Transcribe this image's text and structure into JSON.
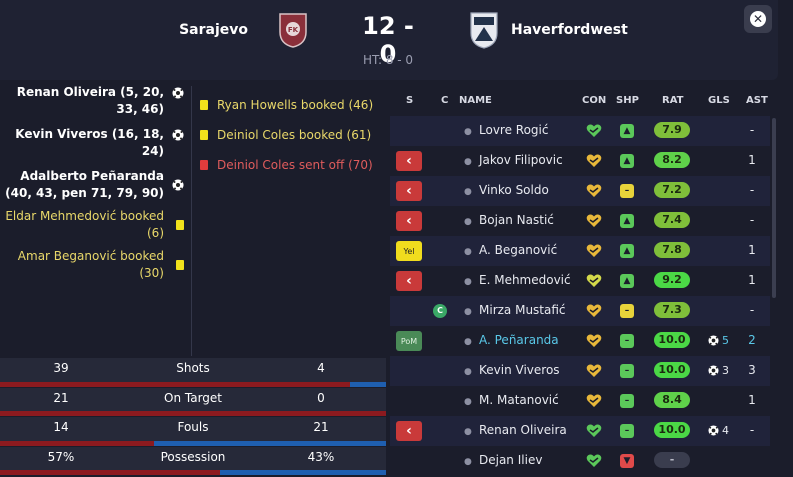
{
  "header": {
    "home_team": "Sarajevo",
    "away_team": "Haverfordwest",
    "score": "12 - 0",
    "half_time": "HT: 8 - 0",
    "close_icon": "close-icon"
  },
  "home_events": [
    {
      "type": "goal",
      "text": "Renan Oliveira (5, 20, 33, 46)"
    },
    {
      "type": "goal",
      "text": "Kevin Viveros (16, 18, 24)"
    },
    {
      "type": "goal",
      "text": "Adalberto Peñaranda (40, 43, pen 71, 79, 90)"
    },
    {
      "type": "book",
      "text": "Eldar Mehmedović booked (6)"
    },
    {
      "type": "book",
      "text": "Amar Beganović booked (30)"
    }
  ],
  "away_events": [
    {
      "type": "book",
      "text": "Ryan Howells booked (46)"
    },
    {
      "type": "book",
      "text": "Deiniol Coles booked (61)"
    },
    {
      "type": "off",
      "text": "Deiniol Coles sent off (70)"
    }
  ],
  "stats": [
    {
      "label": "Shots",
      "home": "39",
      "away": "4",
      "home_share": 0.907
    },
    {
      "label": "On Target",
      "home": "21",
      "away": "0",
      "home_share": 1.0
    },
    {
      "label": "Fouls",
      "home": "14",
      "away": "21",
      "home_share": 0.4
    },
    {
      "label": "Possession",
      "home": "57%",
      "away": "43%",
      "home_share": 0.57
    }
  ],
  "table": {
    "headers": {
      "s": "S",
      "c": "C",
      "name": "NAME",
      "con": "CON",
      "shp": "SHP",
      "rat": "RAT",
      "gls": "GLS",
      "ast": "AST"
    },
    "rows": [
      {
        "s": "",
        "name": "Lovre Rogić",
        "shp": "up",
        "rat": "7.9",
        "gls": "",
        "ast": "-"
      },
      {
        "s": "sub",
        "name": "Jakov Filipovic",
        "shp": "up",
        "rat": "8.2",
        "gls": "",
        "ast": "1"
      },
      {
        "s": "sub",
        "name": "Vinko Soldo",
        "shp": "mid-y",
        "rat": "7.2",
        "gls": "",
        "ast": "-"
      },
      {
        "s": "sub",
        "name": "Bojan Nastić",
        "shp": "up",
        "rat": "7.4",
        "gls": "",
        "ast": "-"
      },
      {
        "s": "Yel",
        "name": "A. Beganović",
        "shp": "up",
        "rat": "7.8",
        "gls": "",
        "ast": "1"
      },
      {
        "s": "sub",
        "name": "E. Mehmedović",
        "shp": "up",
        "rat": "9.2",
        "gls": "",
        "ast": "1"
      },
      {
        "s": "",
        "captain": "C",
        "name": "Mirza Mustafić",
        "shp": "mid-y",
        "rat": "7.3",
        "gls": "",
        "ast": "-"
      },
      {
        "s": "PoM",
        "name": "A. Peñaranda",
        "shp": "mid-g",
        "rat": "10.0",
        "gls": "5",
        "ast": "2"
      },
      {
        "s": "",
        "name": "Kevin Viveros",
        "shp": "mid-g",
        "rat": "10.0",
        "gls": "3",
        "ast": "3"
      },
      {
        "s": "",
        "name": "M. Matanović",
        "shp": "mid-g",
        "rat": "8.4",
        "gls": "",
        "ast": "1"
      },
      {
        "s": "sub",
        "name": "Renan Oliveira",
        "shp": "mid-g",
        "rat": "10.0",
        "gls": "4",
        "ast": "-"
      },
      {
        "s": "",
        "name": "Dejan Iliev",
        "shp": "down",
        "rat": "-",
        "gls": "",
        "ast": ""
      }
    ]
  },
  "colors": {
    "home_bar": "#8c1a1f",
    "away_bar": "#1f5fb0",
    "sub_button": "#c93a3a",
    "highlight": "#5ac8e8"
  }
}
